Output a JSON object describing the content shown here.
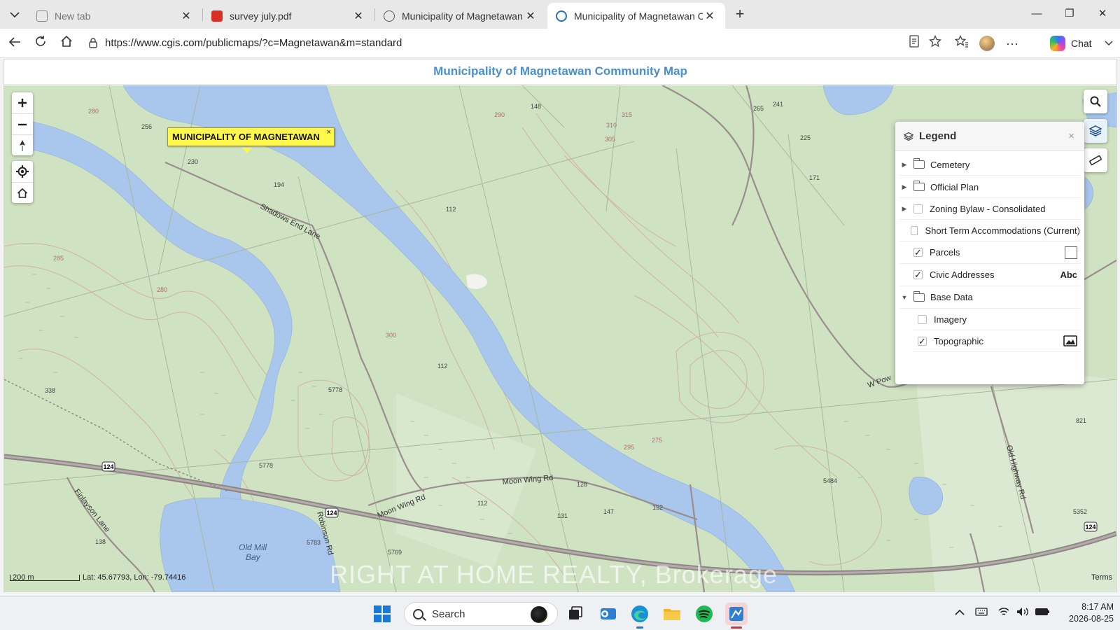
{
  "browser": {
    "tabs": [
      {
        "title": "New tab",
        "icon": "new-tab-icon"
      },
      {
        "title": "survey july.pdf",
        "icon": "pdf-icon"
      },
      {
        "title": "Municipality of Magnetawan",
        "icon": "site-icon"
      },
      {
        "title": "Municipality of Magnetawan Comr",
        "icon": "site-icon",
        "active": true
      }
    ],
    "url": "https://www.cgis.com/publicmaps/?c=Magnetawan&m=standard",
    "chat_label": "Chat"
  },
  "page": {
    "title": "Municipality of Magnetawan Community Map"
  },
  "map": {
    "callout_text": "MUNICIPALITY OF MAGNETAWAN",
    "callout_close": "×",
    "scale_label": "200 m",
    "coords": "Lat: 45.67793, Lon: -79.74416",
    "terms": "Terms",
    "watermark": "RIGHT AT HOME REALTY, Brokerage",
    "labels": {
      "shadows_end": "Shadows End Lane",
      "moon_wing": "Moon Wing Rd",
      "moon_wing2": "Moon Wing Rd",
      "finlayson": "Finlayson Lane",
      "robinson": "Robinson Rd",
      "old_mill": "Old Mill",
      "bay": "Bay",
      "old_highway": "Old Highway Rd",
      "wpow": "W Pow",
      "hwy124a": "124",
      "hwy124b": "124",
      "hwy124c": "124",
      "c5778": "5778",
      "c5778b": "5778",
      "c5783": "5783",
      "c5769": "5769",
      "c5484": "5484",
      "c5352": "5352",
      "c821": "821",
      "c338": "338",
      "c256": "256",
      "c230": "230",
      "c194": "194",
      "c148": "148",
      "c112": "112",
      "c112b": "112",
      "c112c": "112",
      "c138": "138",
      "c131": "131",
      "c147": "147",
      "c152": "152",
      "c241": "241",
      "c225": "225",
      "c265": "265",
      "c171": "171",
      "c128": "128",
      "e280a": "280",
      "e280b": "280",
      "e285a": "285",
      "e290a": "290",
      "e295a": "295",
      "e300": "300",
      "e305": "305",
      "e310": "310",
      "e315": "315",
      "e275": "275"
    }
  },
  "legend": {
    "title": "Legend",
    "close": "×",
    "items": [
      {
        "label": "Cemetery",
        "type": "folder",
        "expanded": false
      },
      {
        "label": "Official Plan",
        "type": "folder",
        "expanded": false
      },
      {
        "label": "Zoning Bylaw - Consolidated",
        "type": "layer-group",
        "checked": false
      },
      {
        "label": "Short Term Accommodations (Current)",
        "type": "layer",
        "checked": false
      },
      {
        "label": "Parcels",
        "type": "layer",
        "checked": true,
        "swatch": "box"
      },
      {
        "label": "Civic Addresses",
        "type": "layer",
        "checked": true,
        "swatch": "Abc"
      },
      {
        "label": "Base Data",
        "type": "folder",
        "expanded": true
      },
      {
        "label": "Imagery",
        "type": "sublayer",
        "checked": false
      },
      {
        "label": "Topographic",
        "type": "sublayer",
        "checked": true,
        "swatch": "image"
      }
    ]
  },
  "taskbar": {
    "search_label": "Search",
    "time": "8:17 AM",
    "date": "2026-08-25"
  },
  "colors": {
    "land": "#cfe2c2",
    "water": "#a9c6ec",
    "contour": "#c9a69b",
    "road": "#8f8585",
    "title_blue": "#4a8fcb",
    "callout_yellow": "#fff84a"
  }
}
